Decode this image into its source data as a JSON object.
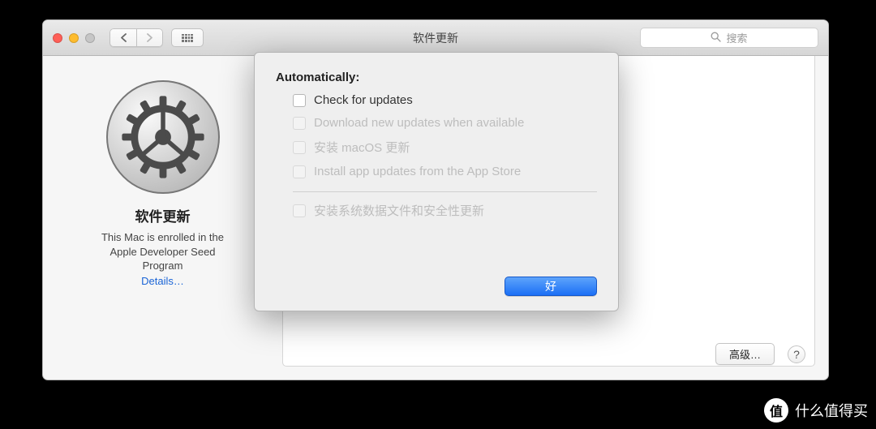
{
  "titlebar": {
    "title": "软件更新",
    "search_placeholder": "搜索"
  },
  "sidebar": {
    "pane_title": "软件更新",
    "enroll_line1": "This Mac is enrolled in the",
    "enroll_line2": "Apple Developer Seed",
    "enroll_line3": "Program",
    "details_link": "Details…"
  },
  "popover": {
    "auto_label": "Automatically:",
    "checkboxes": {
      "check_updates": "Check for updates",
      "download": "Download new updates when available",
      "install_macos": "安装 macOS 更新",
      "install_app": "Install app updates from the App Store",
      "install_system": "安装系统数据文件和安全性更新"
    },
    "ok_label": "好"
  },
  "footer": {
    "advanced_label": "高级…",
    "help_label": "?"
  },
  "watermark": {
    "badge": "值",
    "text": "什么值得买"
  }
}
